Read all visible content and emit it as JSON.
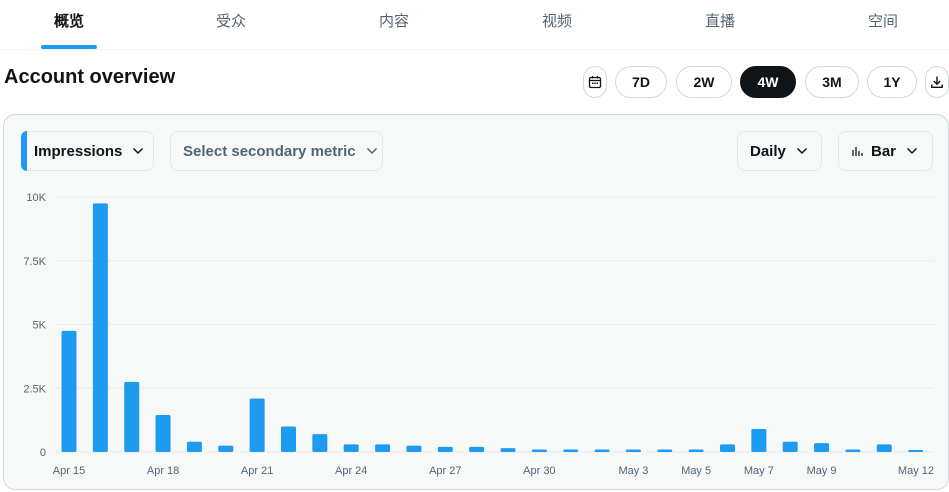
{
  "tabs": [
    {
      "label": "概览",
      "active": true
    },
    {
      "label": "受众",
      "active": false
    },
    {
      "label": "内容",
      "active": false
    },
    {
      "label": "视频",
      "active": false
    },
    {
      "label": "直播",
      "active": false
    },
    {
      "label": "空间",
      "active": false
    }
  ],
  "page_title": "Account overview",
  "range_buttons": [
    {
      "label": "7D",
      "active": false
    },
    {
      "label": "2W",
      "active": false
    },
    {
      "label": "4W",
      "active": true
    },
    {
      "label": "3M",
      "active": false
    },
    {
      "label": "1Y",
      "active": false
    }
  ],
  "controls": {
    "primary_metric": "Impressions",
    "secondary_metric_placeholder": "Select secondary metric",
    "granularity": "Daily",
    "chart_type": "Bar"
  },
  "colors": {
    "accent": "#1d9bf0",
    "bar": "#1d9bf0",
    "active_button": "#0f1419"
  },
  "chart_data": {
    "type": "bar",
    "title": "",
    "xlabel": "",
    "ylabel": "",
    "ylim": [
      0,
      10000
    ],
    "y_ticks": [
      "10K",
      "7.5K",
      "5K",
      "2.5K",
      "0"
    ],
    "y_tick_values": [
      10000,
      7500,
      5000,
      2500,
      0
    ],
    "x_tick_labels": [
      "Apr 15",
      "Apr 18",
      "Apr 21",
      "Apr 24",
      "Apr 27",
      "Apr 30",
      "May 3",
      "May 5",
      "May 7",
      "May 9",
      "May 12"
    ],
    "x_tick_indices": [
      0,
      3,
      6,
      9,
      12,
      15,
      18,
      20,
      22,
      24,
      27
    ],
    "categories": [
      "Apr 15",
      "Apr 16",
      "Apr 17",
      "Apr 18",
      "Apr 19",
      "Apr 20",
      "Apr 21",
      "Apr 22",
      "Apr 23",
      "Apr 24",
      "Apr 25",
      "Apr 26",
      "Apr 27",
      "Apr 28",
      "Apr 29",
      "Apr 30",
      "May 1",
      "May 2",
      "May 3",
      "May 4",
      "May 5",
      "May 6",
      "May 7",
      "May 8",
      "May 9",
      "May 10",
      "May 11",
      "May 12"
    ],
    "values": [
      4750,
      9750,
      2750,
      1450,
      400,
      250,
      2100,
      1000,
      700,
      300,
      300,
      250,
      200,
      200,
      150,
      100,
      100,
      100,
      100,
      100,
      100,
      300,
      900,
      400,
      350,
      100,
      300,
      80
    ],
    "grid": true
  }
}
